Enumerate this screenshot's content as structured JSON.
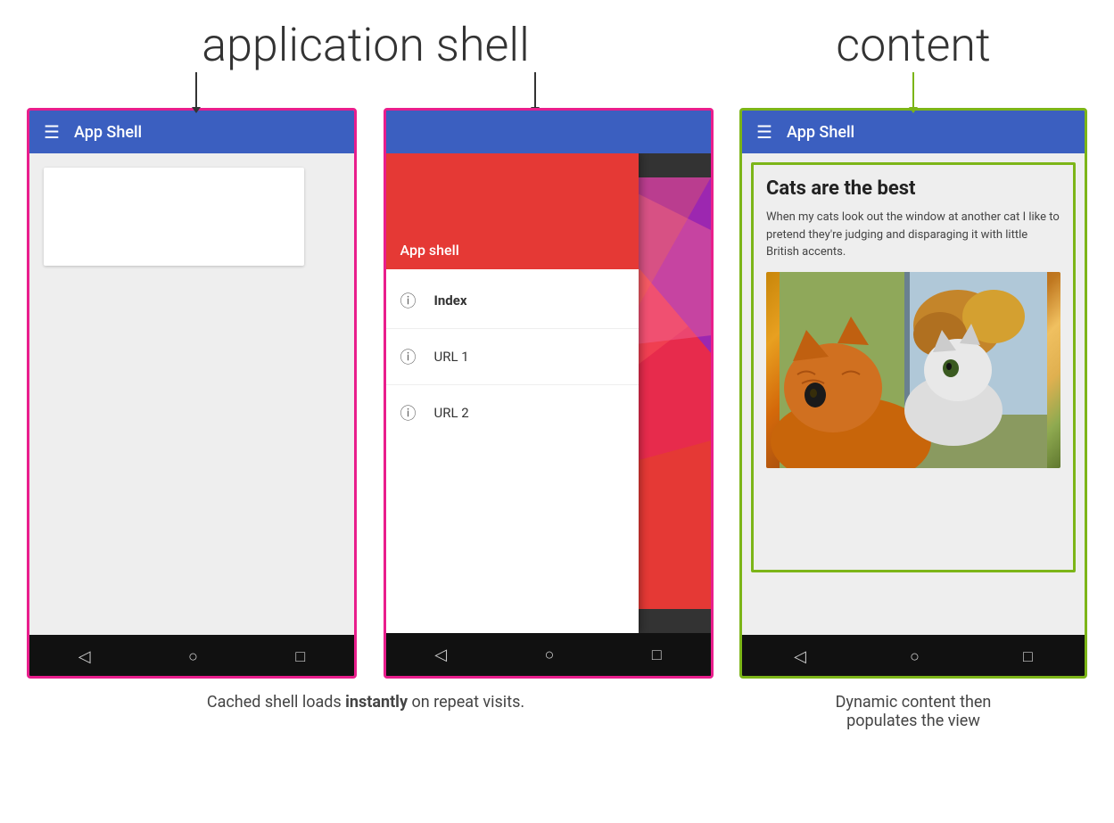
{
  "header": {
    "app_shell_label": "application shell",
    "content_label": "content"
  },
  "phone1": {
    "app_bar_title": "App Shell",
    "hamburger": "☰"
  },
  "phone2": {
    "app_bar_title": "",
    "drawer_header_text": "App shell",
    "nav_items": [
      {
        "label": "Index",
        "active": true
      },
      {
        "label": "URL 1",
        "active": false
      },
      {
        "label": "URL 2",
        "active": false
      }
    ]
  },
  "phone3": {
    "app_bar_title": "App Shell",
    "hamburger": "☰",
    "content": {
      "title": "Cats are the best",
      "body": "When my cats look out the window at another cat I like to pretend they're judging and disparaging it with little British accents."
    }
  },
  "nav_icons": {
    "back": "◁",
    "home": "○",
    "recents": "□"
  },
  "captions": {
    "left": "Cached shell loads instantly on repeat visits.",
    "left_bold": "instantly",
    "right_line1": "Dynamic content then",
    "right_line2": "populates the view"
  }
}
